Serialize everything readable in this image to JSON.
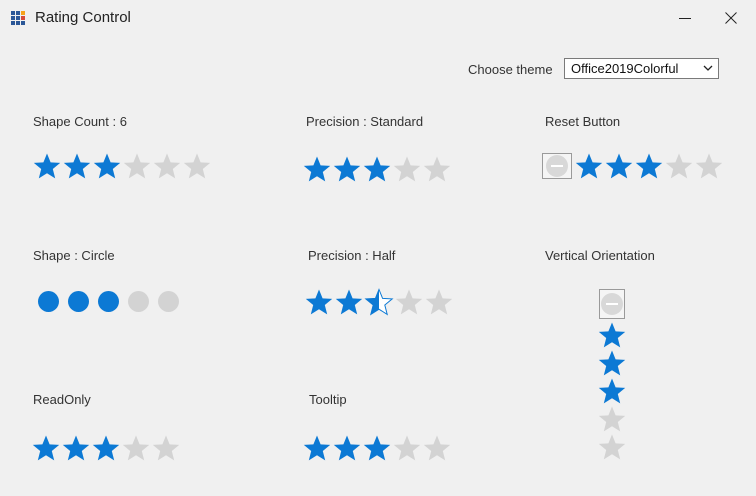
{
  "window": {
    "title": "Rating Control",
    "icon": "app-grid-icon"
  },
  "theme": {
    "label": "Choose theme",
    "value": "Office2019Colorful"
  },
  "colors": {
    "filled": "#0c79d4",
    "empty": "#d3d3d3"
  },
  "examples": {
    "shape_count": {
      "label": "Shape Count : 6",
      "value": 3,
      "count": 6
    },
    "precision_standard": {
      "label": "Precision : Standard",
      "value": 3,
      "count": 5
    },
    "reset_button": {
      "label": "Reset Button",
      "value": 3,
      "count": 5
    },
    "shape_circle": {
      "label": "Shape : Circle",
      "value": 3,
      "count": 5
    },
    "precision_half": {
      "label": "Precision : Half",
      "value": 2.5,
      "count": 5
    },
    "vertical": {
      "label": "Vertical Orientation",
      "value": 3,
      "count": 5
    },
    "readonly": {
      "label": "ReadOnly",
      "value": 3,
      "count": 5
    },
    "tooltip": {
      "label": "Tooltip",
      "value": 3,
      "count": 5
    }
  }
}
